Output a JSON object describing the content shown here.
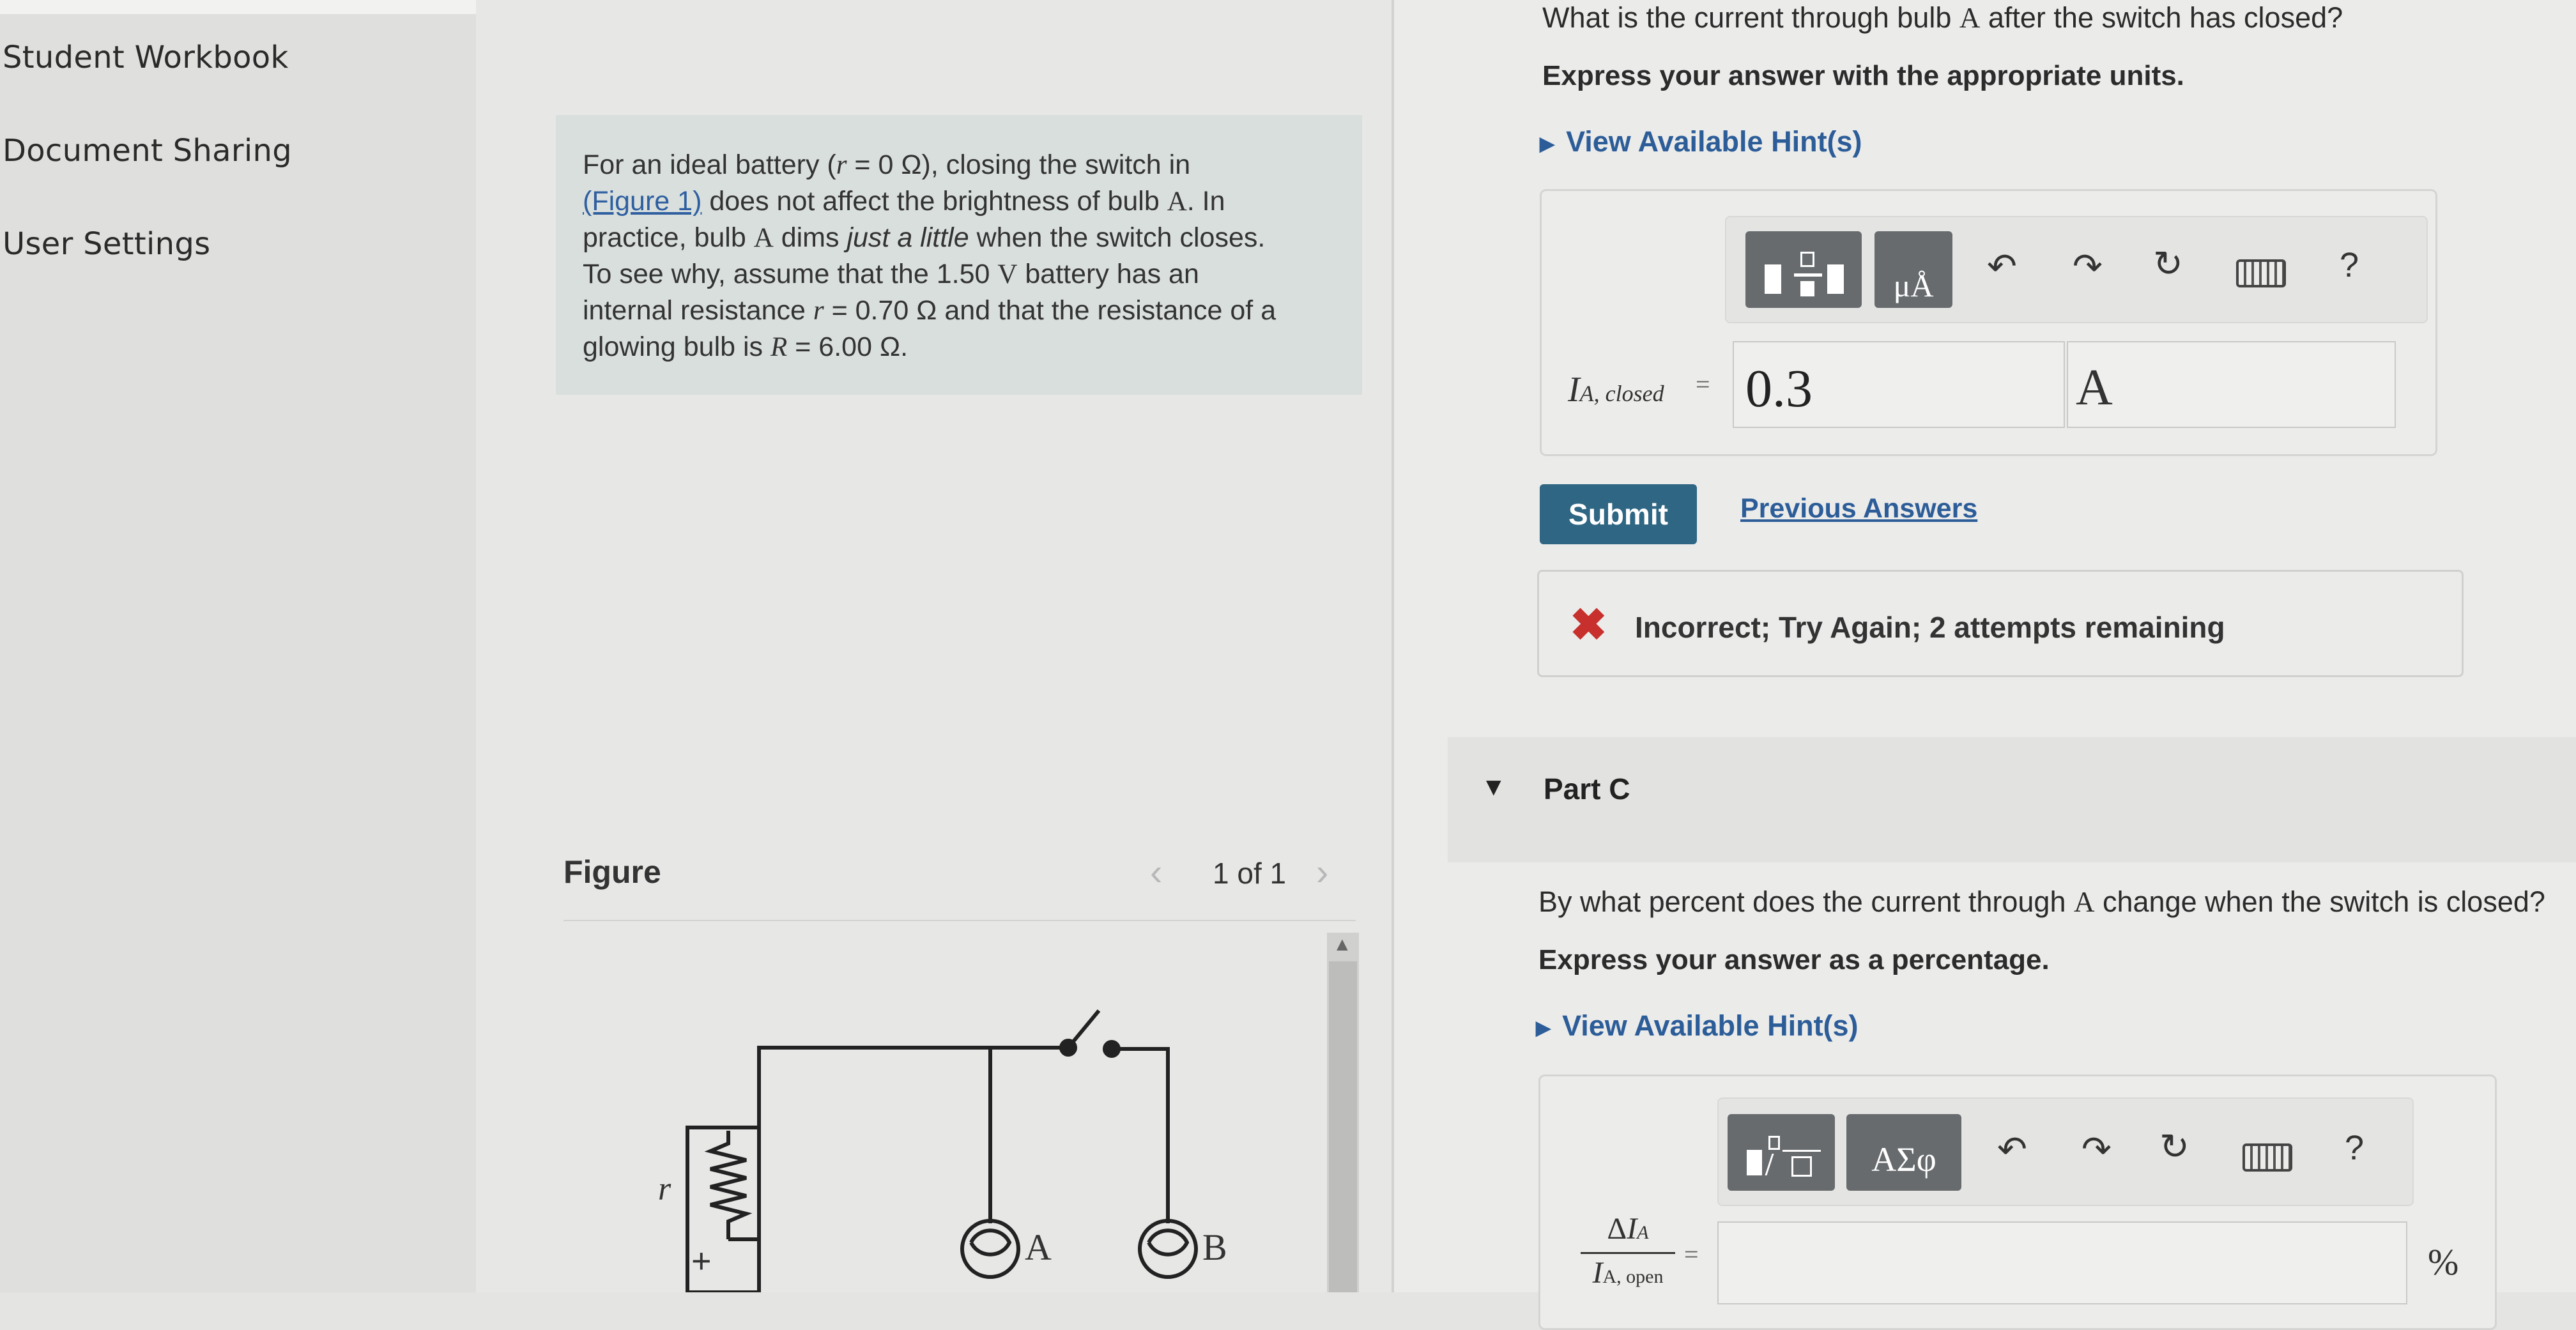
{
  "sidebar": {
    "items": [
      {
        "label": "Student Workbook"
      },
      {
        "label": "Document Sharing"
      },
      {
        "label": "User Settings"
      }
    ]
  },
  "problem": {
    "l1_a": "For an ideal battery (",
    "l1_r": "r",
    "l1_b": " = 0 Ω), closing the switch in",
    "l2_link": "(Figure 1)",
    "l2_b": " does not affect the brightness of bulb ",
    "l2_A": "A",
    "l2_c": ". In",
    "l3_a": "practice, bulb ",
    "l3_A": "A",
    "l3_b": " dims ",
    "l3_it": "just a little",
    "l3_c": " when the switch closes.",
    "l4_a": "To see why, assume that the 1.50 ",
    "l4_V": "V",
    "l4_b": " battery has an",
    "l5_a": "internal resistance ",
    "l5_r": "r",
    "l5_b": " = 0.70 Ω and that the resistance of a",
    "l6_a": "glowing bulb is ",
    "l6_R": "R",
    "l6_b": " = 6.00 Ω."
  },
  "figure": {
    "title": "Figure",
    "counter": "1 of 1",
    "prev_icon": "chevron-left-icon",
    "next_icon": "chevron-right-icon",
    "r_label": "r",
    "plus": "+",
    "bulb_a": "A",
    "bulb_b": "B"
  },
  "partB": {
    "question_a": "What is the current through bulb ",
    "question_A": "A",
    "question_b": " after the switch has closed?",
    "instructions": "Express your answer with the appropriate units.",
    "hint": "View Available Hint(s)",
    "label_I": "I",
    "label_sub": "A, closed",
    "equals": "=",
    "value": "0.3",
    "unit": "A",
    "toolbar": {
      "btn1_icon": "templates-icon",
      "btn2_text": "μÅ",
      "undo_icon": "undo-icon",
      "redo_icon": "redo-icon",
      "reset_icon": "reset-icon",
      "keyboard_icon": "keyboard-icon",
      "help": "?"
    },
    "submit": "Submit",
    "previous_answers": "Previous Answers",
    "feedback_icon": "✖",
    "feedback": "Incorrect; Try Again; 2 attempts remaining"
  },
  "partC": {
    "title": "Part C",
    "question_a": "By what percent does the current through ",
    "question_A": "A",
    "question_b": " change when the switch is closed?",
    "instructions": "Express your answer as a percentage.",
    "hint": "View Available Hint(s)",
    "toolbar": {
      "btn1_icon": "templates-icon",
      "btn2_text": "ΑΣφ",
      "help": "?"
    },
    "frac_num_delta": "Δ",
    "frac_num_I": "I",
    "frac_num_sub": "A",
    "frac_den_I": "I",
    "frac_den_sub": "A, open",
    "equals": "=",
    "value": "",
    "unit": "%"
  },
  "colors": {
    "accent": "#2e6683",
    "link": "#2c5d98",
    "error": "#c7302c"
  }
}
